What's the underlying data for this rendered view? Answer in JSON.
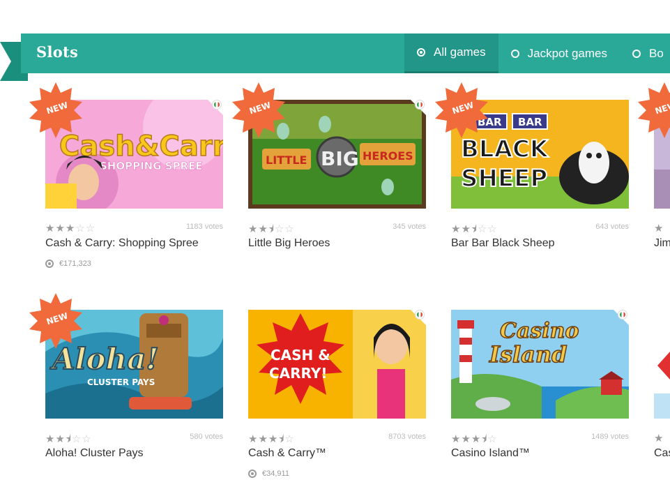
{
  "header": {
    "title": "Slots",
    "tabs": [
      {
        "label": "All games",
        "active": true
      },
      {
        "label": "Jackpot games",
        "active": false
      },
      {
        "label": "Bo",
        "active": false
      }
    ]
  },
  "badge_label": "NEW",
  "games": [
    {
      "name": "Cash & Carry: Shopping Spree",
      "votes": "1183 votes",
      "stars": 3,
      "jackpot": "€171,323",
      "new": true
    },
    {
      "name": "Little Big Heroes",
      "votes": "345 votes",
      "stars": 2.5,
      "new": true
    },
    {
      "name": "Bar Bar Black Sheep",
      "votes": "643 votes",
      "stars": 2.5,
      "new": true
    },
    {
      "name": "Jim",
      "new": true
    },
    {
      "name": "Aloha! Cluster Pays",
      "votes": "580 votes",
      "stars": 2.5,
      "new": true
    },
    {
      "name": "Cash & Carry™",
      "votes": "8703 votes",
      "stars": 3.5,
      "jackpot": "€34,911"
    },
    {
      "name": "Casino Island™",
      "votes": "1489 votes",
      "stars": 3.5
    },
    {
      "name": "Cas"
    }
  ],
  "thumb_text": {
    "cash_carry_spree_1": "Cash&Carry",
    "cash_carry_spree_2": "SHOPPING SPREE",
    "little": "LITTLE",
    "big": "BIG",
    "heroes": "HEROES",
    "bar1": "BAR",
    "bar2": "BAR",
    "black": "BLACK",
    "sheep": "SHEEP",
    "aloha": "Aloha!",
    "cluster_pays": "CLUSTER PAYS",
    "cash_and": "CASH &",
    "carry": "CARRY!",
    "casino": "Casino",
    "island": "Island"
  }
}
